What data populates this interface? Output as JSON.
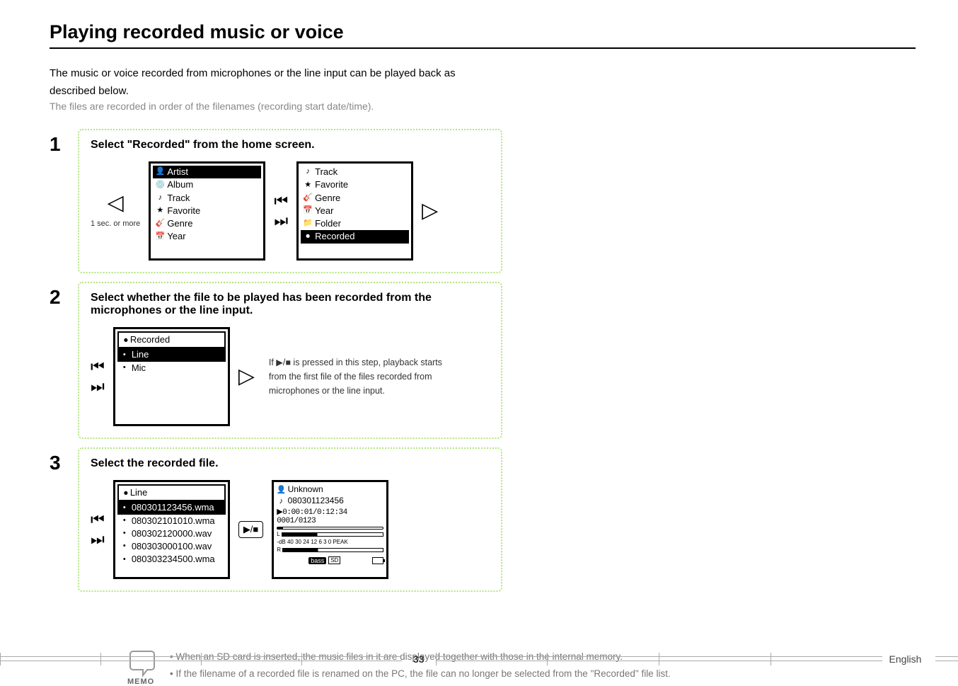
{
  "heading": "Playing recorded music or voice",
  "intro_line1": "The music or voice recorded from microphones or the line input can be played back as",
  "intro_line2": "described below.",
  "intro_sub": "The files are recorded in order of the filenames (recording start date/time).",
  "steps": {
    "s1": {
      "num": "1",
      "title": "Select \"Recorded\" from the home screen.",
      "nav_caption": "1 sec. or more",
      "screen_left_header": "Artist",
      "screen_left_items": [
        "Album",
        "Track",
        "Favorite",
        "Genre",
        "Year"
      ],
      "screen_right_items": [
        "Track",
        "Favorite",
        "Genre",
        "Year",
        "Folder"
      ],
      "screen_right_selected": "Recorded"
    },
    "s2": {
      "num": "2",
      "title": "Select whether the file to be played has been recorded from the microphones or the line input.",
      "screen_header": "Recorded",
      "screen_sel": "Line",
      "screen_items": [
        "Mic"
      ],
      "note_line1": "If ▶/■ is pressed in this step, playback starts",
      "note_line2": "from the first file of the files recorded from",
      "note_line3": "microphones or the line input."
    },
    "s3": {
      "num": "3",
      "title": "Select the recorded file.",
      "screen_left_header": "Line",
      "screen_left_sel": "080301123456.wma",
      "screen_left_items": [
        "080302101010.wma",
        "080302120000.wav",
        "080303000100.wav",
        "080303234500.wma"
      ],
      "play_artist": "Unknown",
      "play_track": "080301123456",
      "play_time": "▶0:00:01/0:12:34 0001/0123",
      "play_db": "-dB 40 30 24   12 6 3 0 PEAK",
      "play_bass": "bass",
      "play_sd": "SD"
    }
  },
  "memo": {
    "label": "MEMO",
    "item1": "When an SD card is inserted, the music files in it are displayed together with those in the internal memory.",
    "item2": "If the filename of a recorded file is renamed on the PC, the file can no longer be selected from the \"Recorded\" file list."
  },
  "footer": {
    "page": "33",
    "lang": "English"
  },
  "icons": {
    "left_tri": "◁",
    "right_tri": "▷",
    "prev": "⏮",
    "next": "⏭",
    "play_stop": "▶/■",
    "artist": "👤",
    "album": "💿",
    "track": "♪",
    "favorite": "★",
    "genre": "🎸",
    "year": "📅",
    "folder": "📁",
    "recorded": "⏺",
    "dot": "•"
  }
}
